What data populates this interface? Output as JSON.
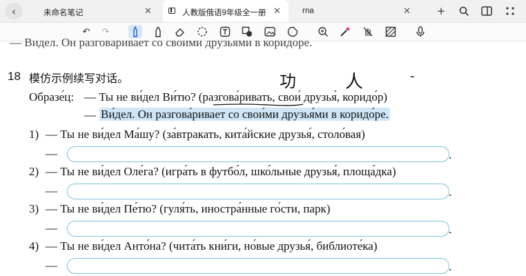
{
  "tabs": [
    {
      "label": "未命名笔记",
      "active": false
    },
    {
      "label": "人教版俄语9年级全一册",
      "active": true
    },
    {
      "label": "rna",
      "active": false
    }
  ],
  "icons": {
    "back": "‹",
    "close": "✕",
    "new_tab": "+",
    "search": "⌕",
    "split_view": "▯",
    "more": "⋮⋮"
  },
  "toolbar": {
    "tools": [
      "undo",
      "redo",
      "pen",
      "highlighter",
      "eraser",
      "lasso",
      "text",
      "shape",
      "image",
      "sticker",
      "zoom",
      "laser",
      "hand-off",
      "pattern",
      "mic"
    ],
    "active_tool": "pen",
    "accent": "#1d5ad6"
  },
  "exercise": {
    "number": "18",
    "instruction": "模仿示例续写对话。",
    "cut_line": "— Видел. Он разговаривает со своими друзьями в коридоре.",
    "sample_label": "Образе́ц:",
    "sample_q": "— Ты не ви́дел Ви́тю? (разгова́ривать, свои́ друзья́, коридо́р)",
    "sample_a_dash": "—",
    "sample_a": "Ви́дел. Он разгова́ривает со свои́ми друзья́ми в коридо́ре.",
    "items": [
      {
        "num": "1)",
        "text": "— Ты не ви́дел Ма́шу? (за́втракать, кита́йские друзья́, столо́вая)"
      },
      {
        "num": "2)",
        "text": "— Ты не ви́дел Оле́га? (игра́ть в футбо́л, шко́льные друзья́, площа́дка)"
      },
      {
        "num": "3)",
        "text": "— Ты не ви́дел Пе́тю? (гуля́ть, иностра́нные го́сти, парк)"
      },
      {
        "num": "4)",
        "text": "—  Ты не ви́дел Анто́на? (чита́ть кни́ги, но́вые друзья́, библиоте́ка)"
      }
    ],
    "answer_dash": "—",
    "answer_end": ".",
    "highlight_color": "#cfe6f7",
    "box_color": "#7cc3dd"
  },
  "handwriting": {
    "notes": [
      "功",
      "人",
      "-"
    ]
  }
}
